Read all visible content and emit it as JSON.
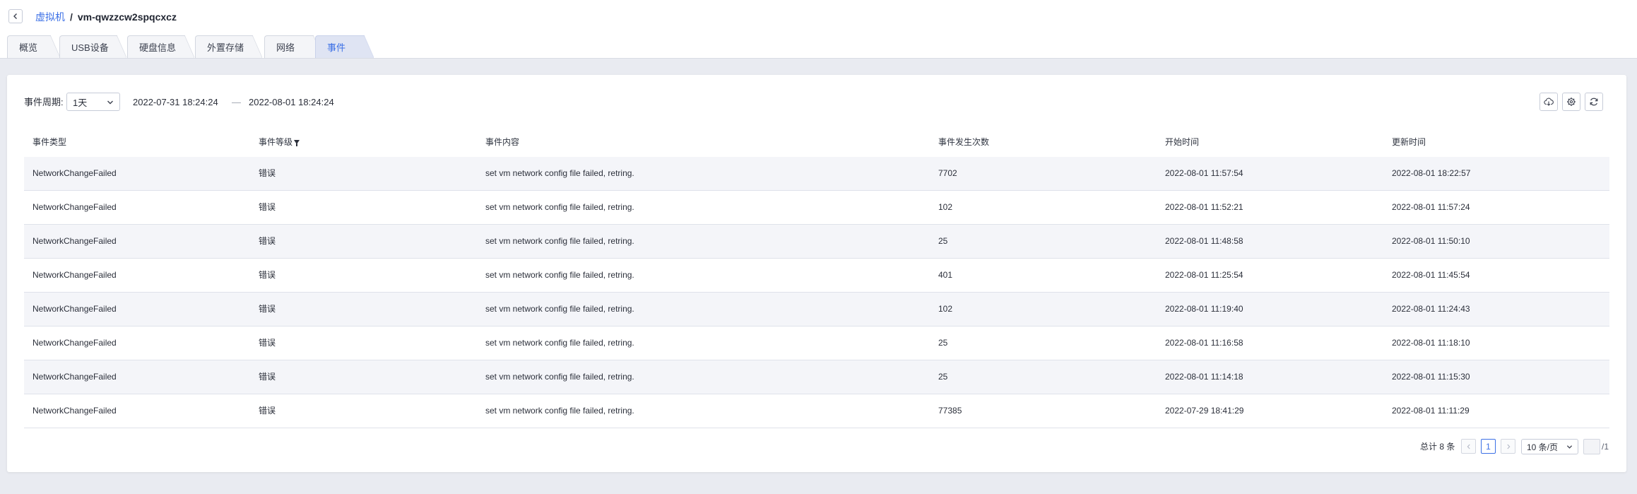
{
  "breadcrumb": {
    "parent": "虚拟机",
    "separator": "/",
    "current": "vm-qwzzcw2spqcxcz"
  },
  "tabs": [
    "概览",
    "USB设备",
    "硬盘信息",
    "外置存储",
    "网络",
    "事件"
  ],
  "active_tab": "事件",
  "filter": {
    "label": "事件周期:",
    "period": "1天",
    "start": "2022-07-31 18:24:24",
    "dash": "—",
    "end": "2022-08-01 18:24:24"
  },
  "toolbar": {
    "icons": [
      "download-icon",
      "settings-icon",
      "refresh-icon"
    ]
  },
  "table": {
    "columns": [
      "事件类型",
      "事件等级",
      "事件内容",
      "事件发生次数",
      "开始时间",
      "更新时间"
    ],
    "rows": [
      {
        "type": "NetworkChangeFailed",
        "level": "错误",
        "content": "set vm network config file failed, retring.",
        "count": "7702",
        "start": "2022-08-01 11:57:54",
        "updated": "2022-08-01 18:22:57"
      },
      {
        "type": "NetworkChangeFailed",
        "level": "错误",
        "content": "set vm network config file failed, retring.",
        "count": "102",
        "start": "2022-08-01 11:52:21",
        "updated": "2022-08-01 11:57:24"
      },
      {
        "type": "NetworkChangeFailed",
        "level": "错误",
        "content": "set vm network config file failed, retring.",
        "count": "25",
        "start": "2022-08-01 11:48:58",
        "updated": "2022-08-01 11:50:10"
      },
      {
        "type": "NetworkChangeFailed",
        "level": "错误",
        "content": "set vm network config file failed, retring.",
        "count": "401",
        "start": "2022-08-01 11:25:54",
        "updated": "2022-08-01 11:45:54"
      },
      {
        "type": "NetworkChangeFailed",
        "level": "错误",
        "content": "set vm network config file failed, retring.",
        "count": "102",
        "start": "2022-08-01 11:19:40",
        "updated": "2022-08-01 11:24:43"
      },
      {
        "type": "NetworkChangeFailed",
        "level": "错误",
        "content": "set vm network config file failed, retring.",
        "count": "25",
        "start": "2022-08-01 11:16:58",
        "updated": "2022-08-01 11:18:10"
      },
      {
        "type": "NetworkChangeFailed",
        "level": "错误",
        "content": "set vm network config file failed, retring.",
        "count": "25",
        "start": "2022-08-01 11:14:18",
        "updated": "2022-08-01 11:15:30"
      },
      {
        "type": "NetworkChangeFailed",
        "level": "错误",
        "content": "set vm network config file failed, retring.",
        "count": "77385",
        "start": "2022-07-29 18:41:29",
        "updated": "2022-08-01 11:11:29"
      }
    ]
  },
  "pagination": {
    "total": "总计 8 条",
    "current_page": "1",
    "page_size": "10 条/页",
    "page_total": "/1"
  },
  "colors": {
    "accent": "#3c70e6",
    "stripe": "#f4f5f9",
    "background": "#e9ebf1"
  }
}
